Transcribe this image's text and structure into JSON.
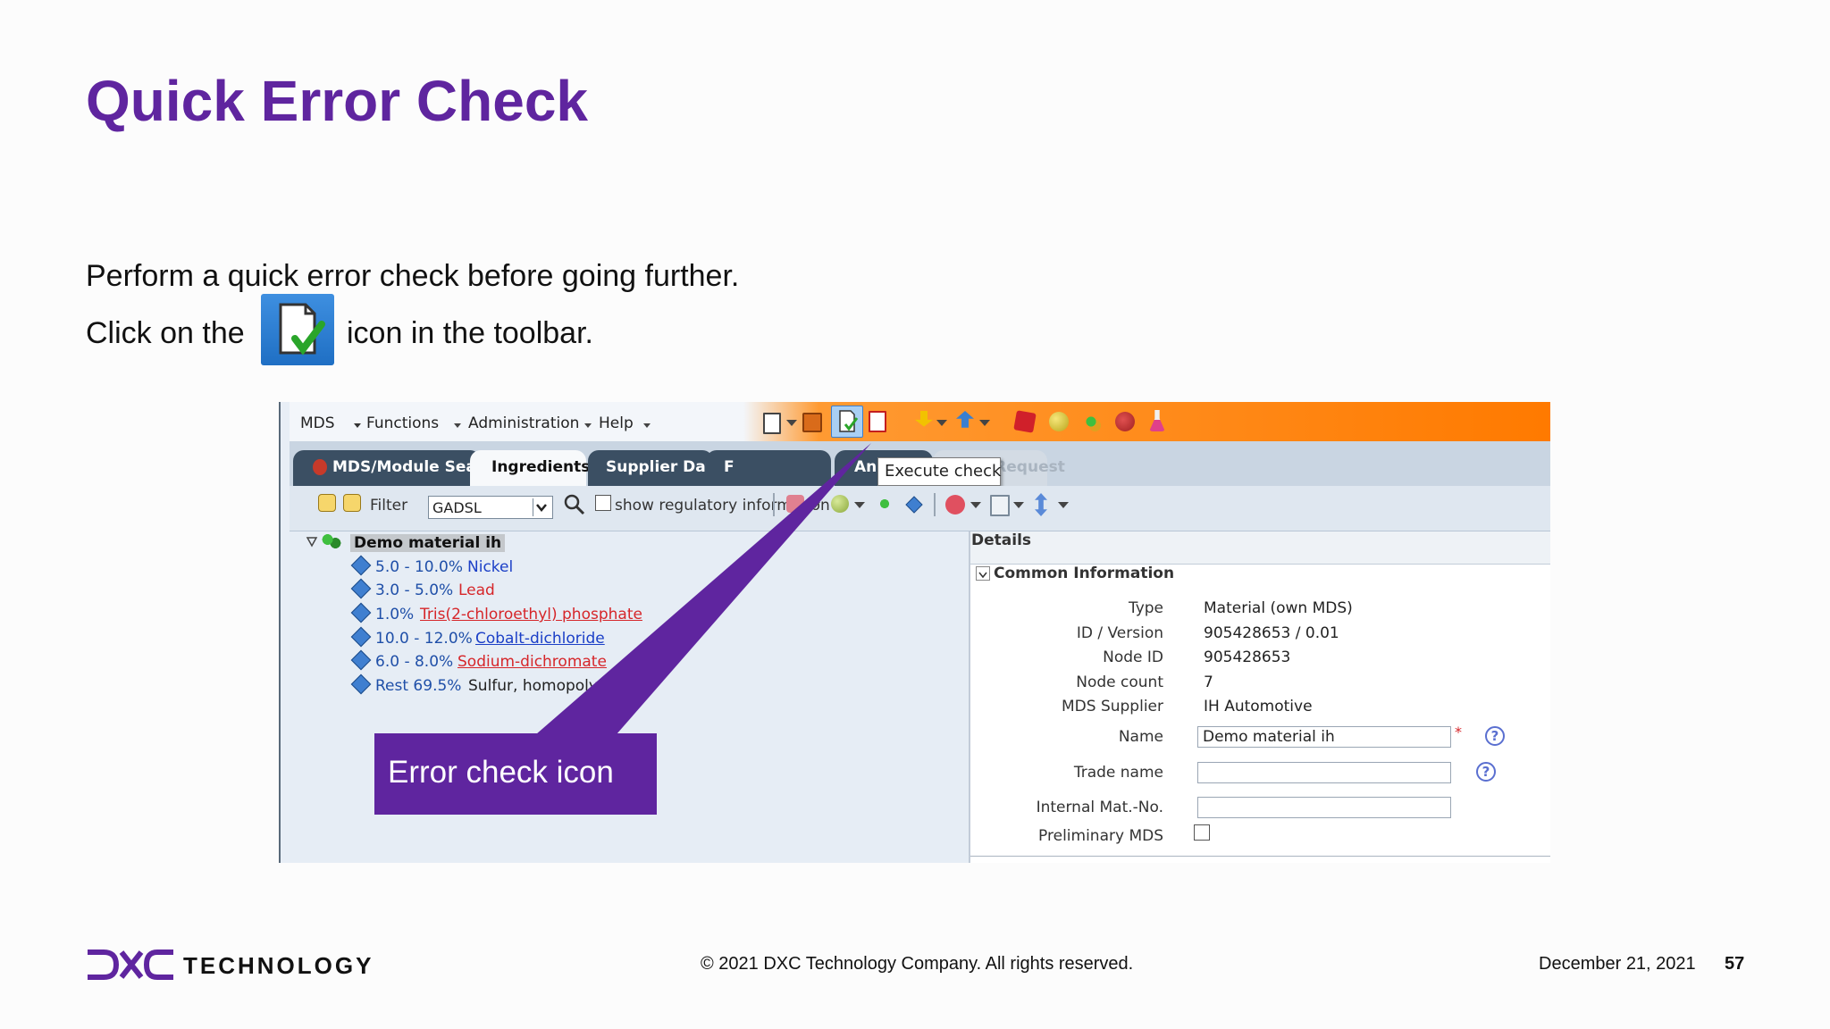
{
  "slide": {
    "title": "Quick Error Check",
    "line1": "Perform a quick error check before going further.",
    "line2_before": "Click on the",
    "line2_after": "icon in the toolbar.",
    "inline_icon": "execute-check-icon"
  },
  "menubar": {
    "items": [
      "MDS",
      "Functions",
      "Administration",
      "Help"
    ],
    "toolbar_icons": [
      "new-document-icon",
      "save-icon",
      "execute-check-icon",
      "pdf-icon",
      "download-icon",
      "upload-icon",
      "red-cube-icon",
      "green-ball-icon",
      "gears-icon",
      "recycle-icon",
      "flask-icon"
    ]
  },
  "tabs": [
    {
      "label": "MDS/Module Search"
    },
    {
      "label": "Ingredients"
    },
    {
      "label": "Supplier Data"
    },
    {
      "label": "F"
    },
    {
      "label": "Analysis"
    },
    {
      "label": "MDS Request"
    }
  ],
  "tooltip": "Execute check",
  "filter": {
    "label": "Filter",
    "value": "GADSL",
    "show_regulatory": "show regulatory information"
  },
  "tree": {
    "root": "Demo material ih",
    "items": [
      {
        "range": "5.0 - 10.0%",
        "name": "Nickel"
      },
      {
        "range": "3.0 - 5.0%",
        "name": "Lead"
      },
      {
        "range": "1.0%",
        "name": "Tris(2-chloroethyl) phosphate"
      },
      {
        "range": "10.0 - 12.0%",
        "name": "Cobalt-dichloride"
      },
      {
        "range": "6.0 - 8.0%",
        "name": "Sodium-dichromate"
      },
      {
        "range": "Rest  69.5%",
        "name": "Sulfur, homopolymer"
      }
    ]
  },
  "details": {
    "heading": "Details",
    "section": "Common Information",
    "type_label": "Type",
    "type_value": "Material (own MDS)",
    "id_label": "ID / Version",
    "id_value": "905428653 / 0.01",
    "node_label": "Node ID",
    "node_value": "905428653",
    "count_label": "Node count",
    "count_value": "7",
    "supplier_label": "MDS Supplier",
    "supplier_value": "IH Automotive",
    "name_label": "Name",
    "name_value": "Demo material ih",
    "trade_label": "Trade name",
    "trade_value": "",
    "internal_label": "Internal Mat.-No.",
    "internal_value": "",
    "prelim_label": "Preliminary MDS",
    "required_mark": "*",
    "help_mark": "?"
  },
  "callout": "Error check icon",
  "footer": {
    "logo_text": "TECHNOLOGY",
    "copyright": "© 2021 DXC Technology Company. All rights reserved.",
    "date": "December 21, 2021",
    "page": "57"
  },
  "colors": {
    "brand_purple": "#5f259f",
    "menubar_orange": "#ff7a00"
  }
}
